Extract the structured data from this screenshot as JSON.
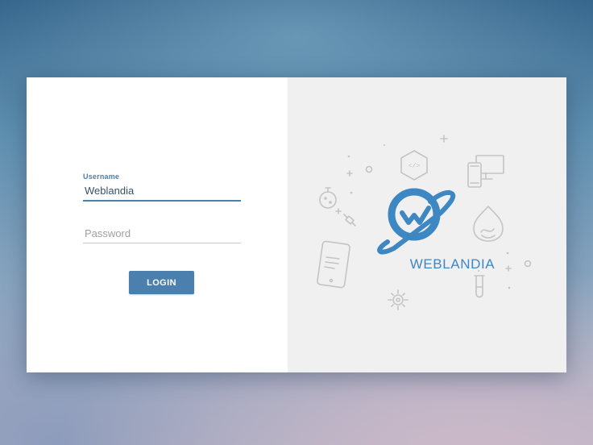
{
  "login": {
    "username_label": "Username",
    "username_value": "Weblandia",
    "password_placeholder": "Password",
    "login_button": "LOGIN"
  },
  "brand": {
    "name": "WEBLANDIA",
    "color": "#3d87c2"
  },
  "colors": {
    "accent": "#4a7fae",
    "panel_right": "#f0f0f0",
    "illustration": "#c4c4c4"
  },
  "icons": [
    "code-hexagon-icon",
    "devices-icon",
    "drupal-icon",
    "mobile-phone-icon",
    "gear-icon",
    "test-tube-icon",
    "compass-icon",
    "satellite-icon",
    "planet-logo-icon"
  ]
}
